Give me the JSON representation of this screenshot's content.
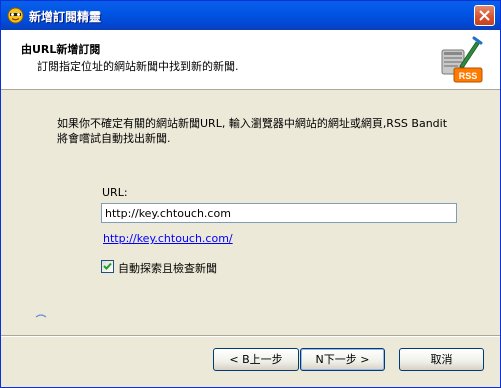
{
  "window": {
    "title": "新增訂閱精靈"
  },
  "header": {
    "title": "由URL新增訂閱",
    "subtitle": "訂閱指定位址的網站新聞中找到新的新聞."
  },
  "main": {
    "description": "如果你不確定有關的網站新聞URL, 輸入瀏覽器中網站的網址或網頁,RSS Bandit將會嚐試自動找出新聞.",
    "url_label": "URL:",
    "url_value": "http://key.chtouch.com",
    "found_link": "http://key.chtouch.com/",
    "checkbox_label": "自動探索且檢查新聞",
    "checkbox_checked": true,
    "rss_badge_text": "RSS"
  },
  "buttons": {
    "back": "< B上一步",
    "next": "N下一步 >",
    "cancel": "取消"
  },
  "colors": {
    "titlebar": "#0055E5",
    "link": "#0000FF",
    "dialog_bg": "#ECE9D8"
  }
}
